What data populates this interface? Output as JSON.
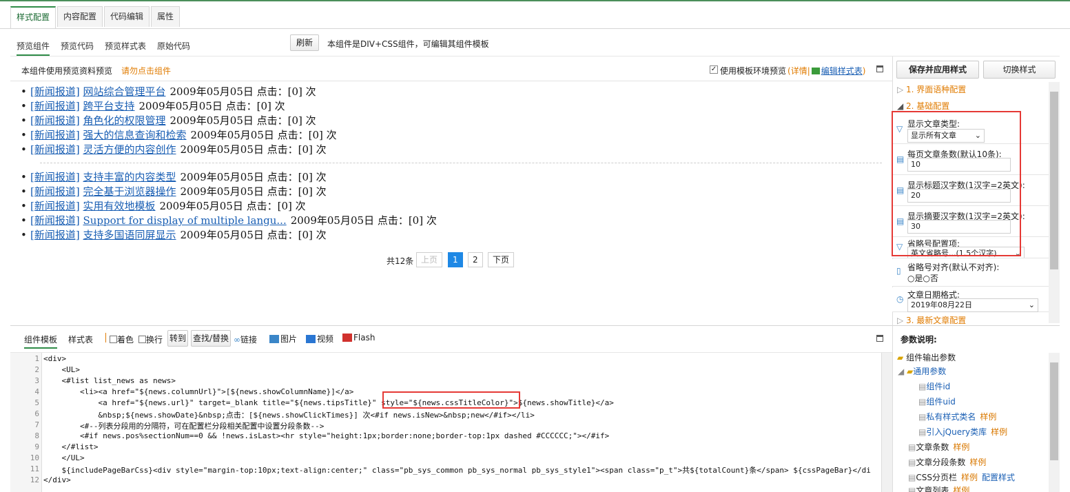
{
  "top_tabs": [
    {
      "label": "样式配置",
      "active": true
    },
    {
      "label": "内容配置"
    },
    {
      "label": "代码编辑"
    },
    {
      "label": "属性"
    }
  ],
  "sub_tabs": [
    {
      "label": "预览组件",
      "active": true
    },
    {
      "label": "预览代码"
    },
    {
      "label": "预览样式表"
    },
    {
      "label": "原始代码"
    }
  ],
  "refresh_label": "刷新",
  "component_note": "本组件是DIV+CSS组件，可编辑其组件模板",
  "preview_header": {
    "note": "本组件使用预览资料预览",
    "warn": "请勿点击组件",
    "use_env": "使用模板环境预览",
    "detail_open": "(",
    "detail": "详情",
    "sep": "|",
    "edit_css": "编辑样式表",
    "detail_close": ")"
  },
  "news_group1": [
    {
      "cat": "[新闻报道]",
      "title": "网站综合管理平台",
      "meta": "2009年05月05日 点击：[0] 次"
    },
    {
      "cat": "[新闻报道]",
      "title": "跨平台支持",
      "meta": "2009年05月05日 点击：[0] 次"
    },
    {
      "cat": "[新闻报道]",
      "title": "角色化的权限管理",
      "meta": "2009年05月05日 点击：[0] 次"
    },
    {
      "cat": "[新闻报道]",
      "title": "强大的信息查询和检索",
      "meta": "2009年05月05日 点击：[0] 次"
    },
    {
      "cat": "[新闻报道]",
      "title": "灵活方便的内容创作",
      "meta": "2009年05月05日 点击：[0] 次"
    }
  ],
  "news_group2": [
    {
      "cat": "[新闻报道]",
      "title": "支持丰富的内容类型",
      "meta": "2009年05月05日 点击：[0] 次"
    },
    {
      "cat": "[新闻报道]",
      "title": "完全基于浏览器操作",
      "meta": "2009年05月05日 点击：[0] 次"
    },
    {
      "cat": "[新闻报道]",
      "title": "实用有效地模板",
      "meta": "2009年05月05日 点击：[0] 次"
    },
    {
      "cat": "[新闻报道]",
      "title": "Support for display of multiple langu...",
      "meta": "2009年05月05日 点击：[0] 次"
    },
    {
      "cat": "[新闻报道]",
      "title": "支持多国语同屏显示",
      "meta": "2009年05月05日 点击：[0] 次"
    }
  ],
  "pager": {
    "total": "共12条",
    "prev": "上页",
    "page1": "1",
    "page2": "2",
    "next": "下页"
  },
  "right": {
    "save_label": "保存并应用样式",
    "switch_label": "切换样式",
    "section1": "1. 界面语种配置",
    "section2": "2. 基础配置",
    "section3": "3. 最新文章配置",
    "fields": {
      "type_label": "显示文章类型:",
      "type_value": "显示所有文章",
      "per_page_label": "每页文章条数(默认10条):",
      "per_page_value": "10",
      "title_len_label": "显示标题汉字数(1汉字=2英文):",
      "title_len_value": "20",
      "summary_len_label": "显示摘要汉字数(1汉字=2英文):",
      "summary_len_value": "30",
      "ellipsis_label": "省略号配置项:",
      "ellipsis_value": "英文省略号...(1.5个汉字)",
      "align_label": "省略号对齐(默认不对齐):",
      "yes": "是",
      "no": "否",
      "date_label": "文章日期格式:",
      "date_value": "2019年08月22日"
    }
  },
  "editor_toolbar": {
    "tab1": "组件模板",
    "tab2": "样式表",
    "color": "着色",
    "wrap": "换行",
    "goto": "转到",
    "find": "查找/替换",
    "link": "链接",
    "image": "图片",
    "video": "视频",
    "flash": "Flash"
  },
  "code_lines": [
    "<div>",
    "    <UL>",
    "    <#list list_news as news>",
    "        <li><a href=\"${news.columnUrl}\">[${news.showColumnName}]</a>",
    "            <a href=\"${news.url}\" target=_blank title=\"${news.tipsTitle}\" style=\"${news.cssTitleColor}\">${news.showTitle}</a>",
    "            &nbsp;${news.showDate}&nbsp;点击：[${news.showClickTimes}] 次<#if news.isNew>&nbsp;new</#if></li>",
    "        <#--列表分段用的分隔符，可在配置栏分段相关配置中设置分段条数-->",
    "        <#if news.pos%sectionNum==0 && !news.isLast><hr style=\"height:1px;border:none;border-top:1px dashed #CCCCCC;\"></#if>",
    "    </#list>",
    "    </UL>",
    "    ${includePageBarCss}<div style=\"margin-top:10px;text-align:center;\" class=\"pb_sys_common pb_sys_normal pb_sys_style1\"><span class=\"p_t\">共${totalCount}条</span> ${cssPageBar}</di",
    "</div>"
  ],
  "params": {
    "title": "参数说明:",
    "root": "组件输出参数",
    "common": "通用参数",
    "items": [
      {
        "name": "组件id",
        "sample": ""
      },
      {
        "name": "组件uid",
        "sample": ""
      },
      {
        "name": "私有样式类名",
        "sample": "样例"
      },
      {
        "name": "引入jQuery类库",
        "sample": "样例"
      }
    ],
    "items2": [
      {
        "name": "文章条数",
        "sample": "样例"
      },
      {
        "name": "文章分段条数",
        "sample": "样例"
      },
      {
        "name": "CSS分页栏",
        "sample": "样例",
        "extra": "配置样式"
      },
      {
        "name": "文章列表",
        "sample": "样例"
      }
    ]
  },
  "colors": {
    "accent": "#2e8b47",
    "link": "#1a5fb4",
    "orange": "#e07b00",
    "highlight": "#e53935"
  }
}
